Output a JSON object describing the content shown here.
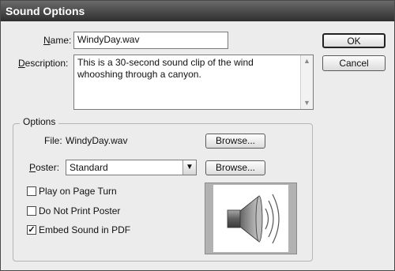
{
  "window": {
    "title": "Sound Options"
  },
  "name_field": {
    "label": "Name:",
    "label_u": "N",
    "label_rest": "ame:",
    "value": "WindyDay.wav"
  },
  "description_field": {
    "label_u": "D",
    "label_rest": "escription:",
    "value": "This is a 30-second sound clip of the wind whooshing through a canyon."
  },
  "buttons": {
    "ok": "OK",
    "cancel": "Cancel"
  },
  "options": {
    "group_title": "Options",
    "file_label": "File:",
    "file_value": "WindyDay.wav",
    "browse_file": "Browse...",
    "poster_label_u": "P",
    "poster_label_rest": "oster:",
    "poster_value": "Standard",
    "browse_poster": "Browse...",
    "checkboxes": [
      {
        "label": "Play on Page Turn",
        "checked": false
      },
      {
        "label": "Do Not Print Poster",
        "checked": false
      },
      {
        "label": "Embed Sound in PDF",
        "checked": true
      }
    ]
  },
  "icons": {
    "scroll_up": "scroll-up-arrow-icon",
    "scroll_down": "scroll-down-arrow-icon",
    "dropdown": "chevron-down-icon",
    "speaker": "speaker-icon"
  }
}
